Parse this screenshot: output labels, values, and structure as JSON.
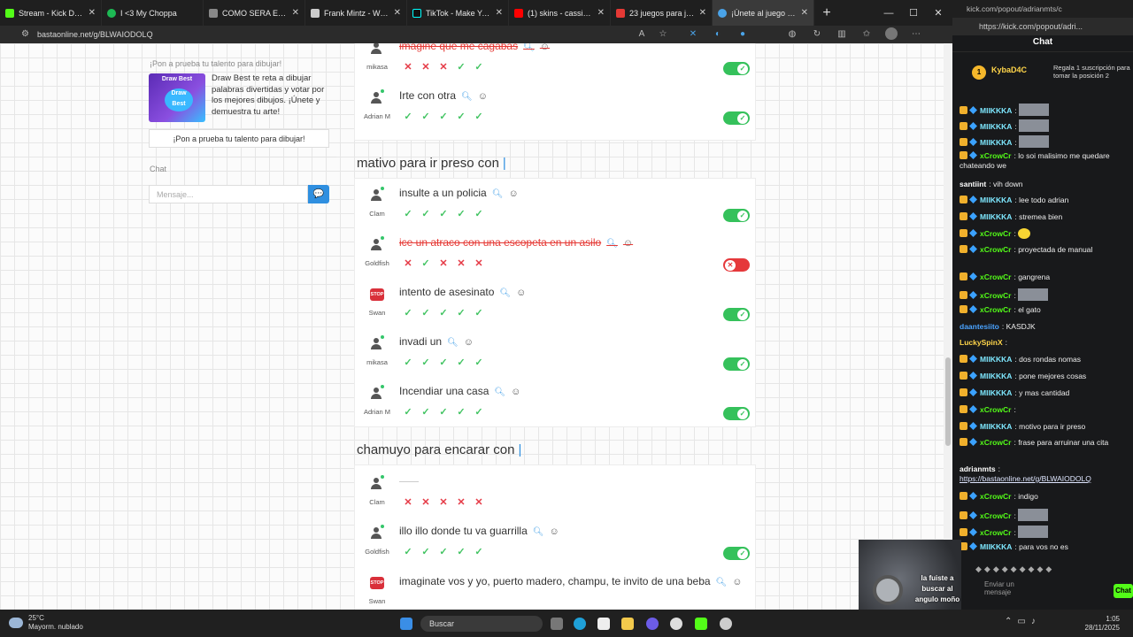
{
  "browser": {
    "tabs": [
      {
        "label": "Stream - Kick Dashboa",
        "color": "#53fc18"
      },
      {
        "label": "I <3 My Choppa",
        "color": "#1db954"
      },
      {
        "label": "COMO SERA EL HOMBR",
        "color": "#888888"
      },
      {
        "label": "Frank Mintz - Wikipedi",
        "color": "#cccccc"
      },
      {
        "label": "TikTok - Make Your Day",
        "color": "#111111"
      },
      {
        "label": "(1) skins - cassie & skl",
        "color": "#ff0000"
      },
      {
        "label": "23 juegos para jugar co",
        "color": "#e53935"
      },
      {
        "label": "¡Únete al juego Basta!",
        "color": "#4aa3e8"
      }
    ],
    "url": "bastaonline.net/g/BLWAIODOLQ",
    "new_tab": "+",
    "min": "—",
    "max": "☐",
    "close": "✕"
  },
  "sidebar": {
    "promo_title": "¡Pon a prueba tu talento para dibujar!",
    "promo_image_title": "Draw Best",
    "promo_image_badge": "Draw Best",
    "promo_text": "Draw Best te reta a dibujar palabras divertidas y votar por los mejores dibujos. ¡Únete y demuestra tu arte!",
    "promo_button": "¡Pon a prueba tu talento para dibujar!",
    "chat_title": "Chat",
    "chat_placeholder": "Mensaje..."
  },
  "sections": [
    {
      "heading": "",
      "rows": [
        {
          "player": "mikasa",
          "answer": "imagine que me cagabas",
          "invalid": true,
          "votes": [
            "no",
            "no",
            "no",
            "ok",
            "ok"
          ],
          "toggle": "on"
        },
        {
          "player": "Adrian M",
          "answer": "Irte con otra",
          "invalid": false,
          "votes": [
            "ok",
            "ok",
            "ok",
            "ok",
            "ok"
          ],
          "toggle": "on"
        }
      ]
    },
    {
      "heading": "mativo para ir preso con",
      "rows": [
        {
          "player": "Clam",
          "answer": "insulte a un policia",
          "invalid": false,
          "votes": [
            "ok",
            "ok",
            "ok",
            "ok",
            "ok"
          ],
          "toggle": "on"
        },
        {
          "player": "Goldfish",
          "answer": "ice un atraco con una escopeta en un asilo",
          "invalid": true,
          "votes": [
            "no",
            "ok",
            "no",
            "no",
            "no"
          ],
          "toggle": "off"
        },
        {
          "player": "Swan",
          "answer": "intento de asesinato",
          "invalid": false,
          "votes": [
            "ok",
            "ok",
            "ok",
            "ok",
            "ok"
          ],
          "toggle": "on",
          "stop": true
        },
        {
          "player": "mikasa",
          "answer": "invadi un",
          "invalid": false,
          "votes": [
            "ok",
            "ok",
            "ok",
            "ok",
            "ok"
          ],
          "toggle": "on"
        },
        {
          "player": "Adrian M",
          "answer": "Incendiar una casa",
          "invalid": false,
          "votes": [
            "ok",
            "ok",
            "ok",
            "ok",
            "ok"
          ],
          "toggle": "on"
        }
      ]
    },
    {
      "heading": "chamuyo para encarar con",
      "rows": [
        {
          "player": "Clam",
          "answer": "",
          "invalid": false,
          "votes": [
            "no",
            "no",
            "no",
            "no",
            "no"
          ],
          "toggle": "none"
        },
        {
          "player": "Goldfish",
          "answer": "illo illo donde tu va guarrilla",
          "invalid": false,
          "votes": [
            "ok",
            "ok",
            "ok",
            "ok",
            "ok"
          ],
          "toggle": "on"
        },
        {
          "player": "Swan",
          "answer": "imaginate vos y yo, puerto madero, champu, te invito de una beba",
          "invalid": false,
          "votes": [],
          "toggle": "none",
          "stop": true
        }
      ]
    }
  ],
  "kick": {
    "tab_url": "kick.com/popout/adrianmts/c",
    "addr_url": "https://kick.com/popout/adri...",
    "title": "Chat",
    "pinned_rank": "1",
    "pinned_user": "KybaD4C",
    "pinned_gift": "Regala 1 suscripción para tomar la posición 2",
    "messages": [
      {
        "user": "MIIKKKA",
        "color": "#7ee8ff",
        "text": "",
        "img": true
      },
      {
        "user": "MIIKKKA",
        "color": "#7ee8ff",
        "text": "",
        "img": true
      },
      {
        "user": "MIIKKKA",
        "color": "#7ee8ff",
        "text": "",
        "img": true
      },
      {
        "user": "xCrowCr",
        "color": "#53fc18",
        "text": "lo soi malisimo me quedare chateando we"
      },
      {
        "user": "santiint",
        "color": "#ffffff",
        "text": "vih down"
      },
      {
        "user": "MIIKKKA",
        "color": "#7ee8ff",
        "text": "lee todo adrian"
      },
      {
        "user": "MIIKKKA",
        "color": "#7ee8ff",
        "text": "stremea bien"
      },
      {
        "user": "xCrowCr",
        "color": "#53fc18",
        "text": "",
        "emote": true
      },
      {
        "user": "xCrowCr",
        "color": "#53fc18",
        "text": "proyectada de manual"
      },
      {
        "user": "xCrowCr",
        "color": "#53fc18",
        "text": "gangrena"
      },
      {
        "user": "xCrowCr",
        "color": "#53fc18",
        "text": "",
        "img": true
      },
      {
        "user": "xCrowCr",
        "color": "#53fc18",
        "text": "el gato"
      },
      {
        "user": "daantesiito",
        "color": "#4aa3ff",
        "text": "KASDJK"
      },
      {
        "user": "LuckySpinX",
        "color": "#ffd54a",
        "text": ""
      },
      {
        "user": "MIIKKKA",
        "color": "#7ee8ff",
        "text": "dos rondas nomas"
      },
      {
        "user": "MIIKKKA",
        "color": "#7ee8ff",
        "text": "pone mejores cosas"
      },
      {
        "user": "MIIKKKA",
        "color": "#7ee8ff",
        "text": "y mas cantidad"
      },
      {
        "user": "xCrowCr",
        "color": "#53fc18",
        "text": ""
      },
      {
        "user": "MIIKKKA",
        "color": "#7ee8ff",
        "text": "motivo para ir preso"
      },
      {
        "user": "xCrowCr",
        "color": "#53fc18",
        "text": "frase para arruinar una cita"
      },
      {
        "user": "adrianmts",
        "color": "#ffffff",
        "text": ""
      },
      {
        "user": "xCrowCr",
        "color": "#53fc18",
        "text": "indigo"
      },
      {
        "user": "xCrowCr",
        "color": "#53fc18",
        "text": "",
        "img": true
      },
      {
        "user": "xCrowCr",
        "color": "#53fc18",
        "text": "",
        "img": true
      },
      {
        "user": "MIIKKKA",
        "color": "#7ee8ff",
        "text": "para vos no es"
      }
    ],
    "link": "https://bastaonline.net/g/BLWAIODOLQ",
    "send_placeholder": "Enviar un mensaje",
    "chat_button": "Chat",
    "webcam_caption": "la fuiste a buscar al angulo moño"
  },
  "taskbar": {
    "temp": "25°C",
    "weather": "Mayorm. nublado",
    "search": "Buscar",
    "time": "1:05",
    "date": "28/11/2025"
  }
}
